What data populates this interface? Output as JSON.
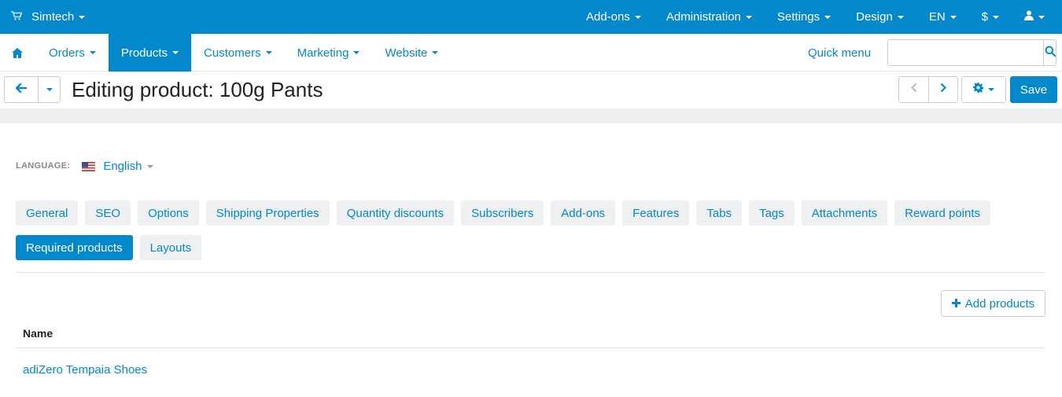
{
  "topbar": {
    "store_name": "Simtech",
    "menu": [
      "Add-ons",
      "Administration",
      "Settings",
      "Design",
      "EN",
      "$"
    ]
  },
  "mainnav": {
    "items": [
      {
        "label": "Orders",
        "active": false
      },
      {
        "label": "Products",
        "active": true
      },
      {
        "label": "Customers",
        "active": false
      },
      {
        "label": "Marketing",
        "active": false
      },
      {
        "label": "Website",
        "active": false
      }
    ],
    "quick_menu": "Quick menu",
    "search_placeholder": ""
  },
  "titlebar": {
    "title": "Editing product: 100g Pants",
    "save_label": "Save"
  },
  "language": {
    "label": "LANGUAGE:",
    "value": "English"
  },
  "tabs": [
    {
      "label": "General",
      "active": false
    },
    {
      "label": "SEO",
      "active": false
    },
    {
      "label": "Options",
      "active": false
    },
    {
      "label": "Shipping Properties",
      "active": false
    },
    {
      "label": "Quantity discounts",
      "active": false
    },
    {
      "label": "Subscribers",
      "active": false
    },
    {
      "label": "Add-ons",
      "active": false
    },
    {
      "label": "Features",
      "active": false
    },
    {
      "label": "Tabs",
      "active": false
    },
    {
      "label": "Tags",
      "active": false
    },
    {
      "label": "Attachments",
      "active": false
    },
    {
      "label": "Reward points",
      "active": false
    },
    {
      "label": "Required products",
      "active": true
    },
    {
      "label": "Layouts",
      "active": false
    }
  ],
  "required_products": {
    "add_label": "Add products",
    "column_name": "Name",
    "rows": [
      "adiZero Tempaia Shoes"
    ]
  },
  "colors": {
    "primary": "#0388cc",
    "tab_bg": "#eef0f2"
  }
}
